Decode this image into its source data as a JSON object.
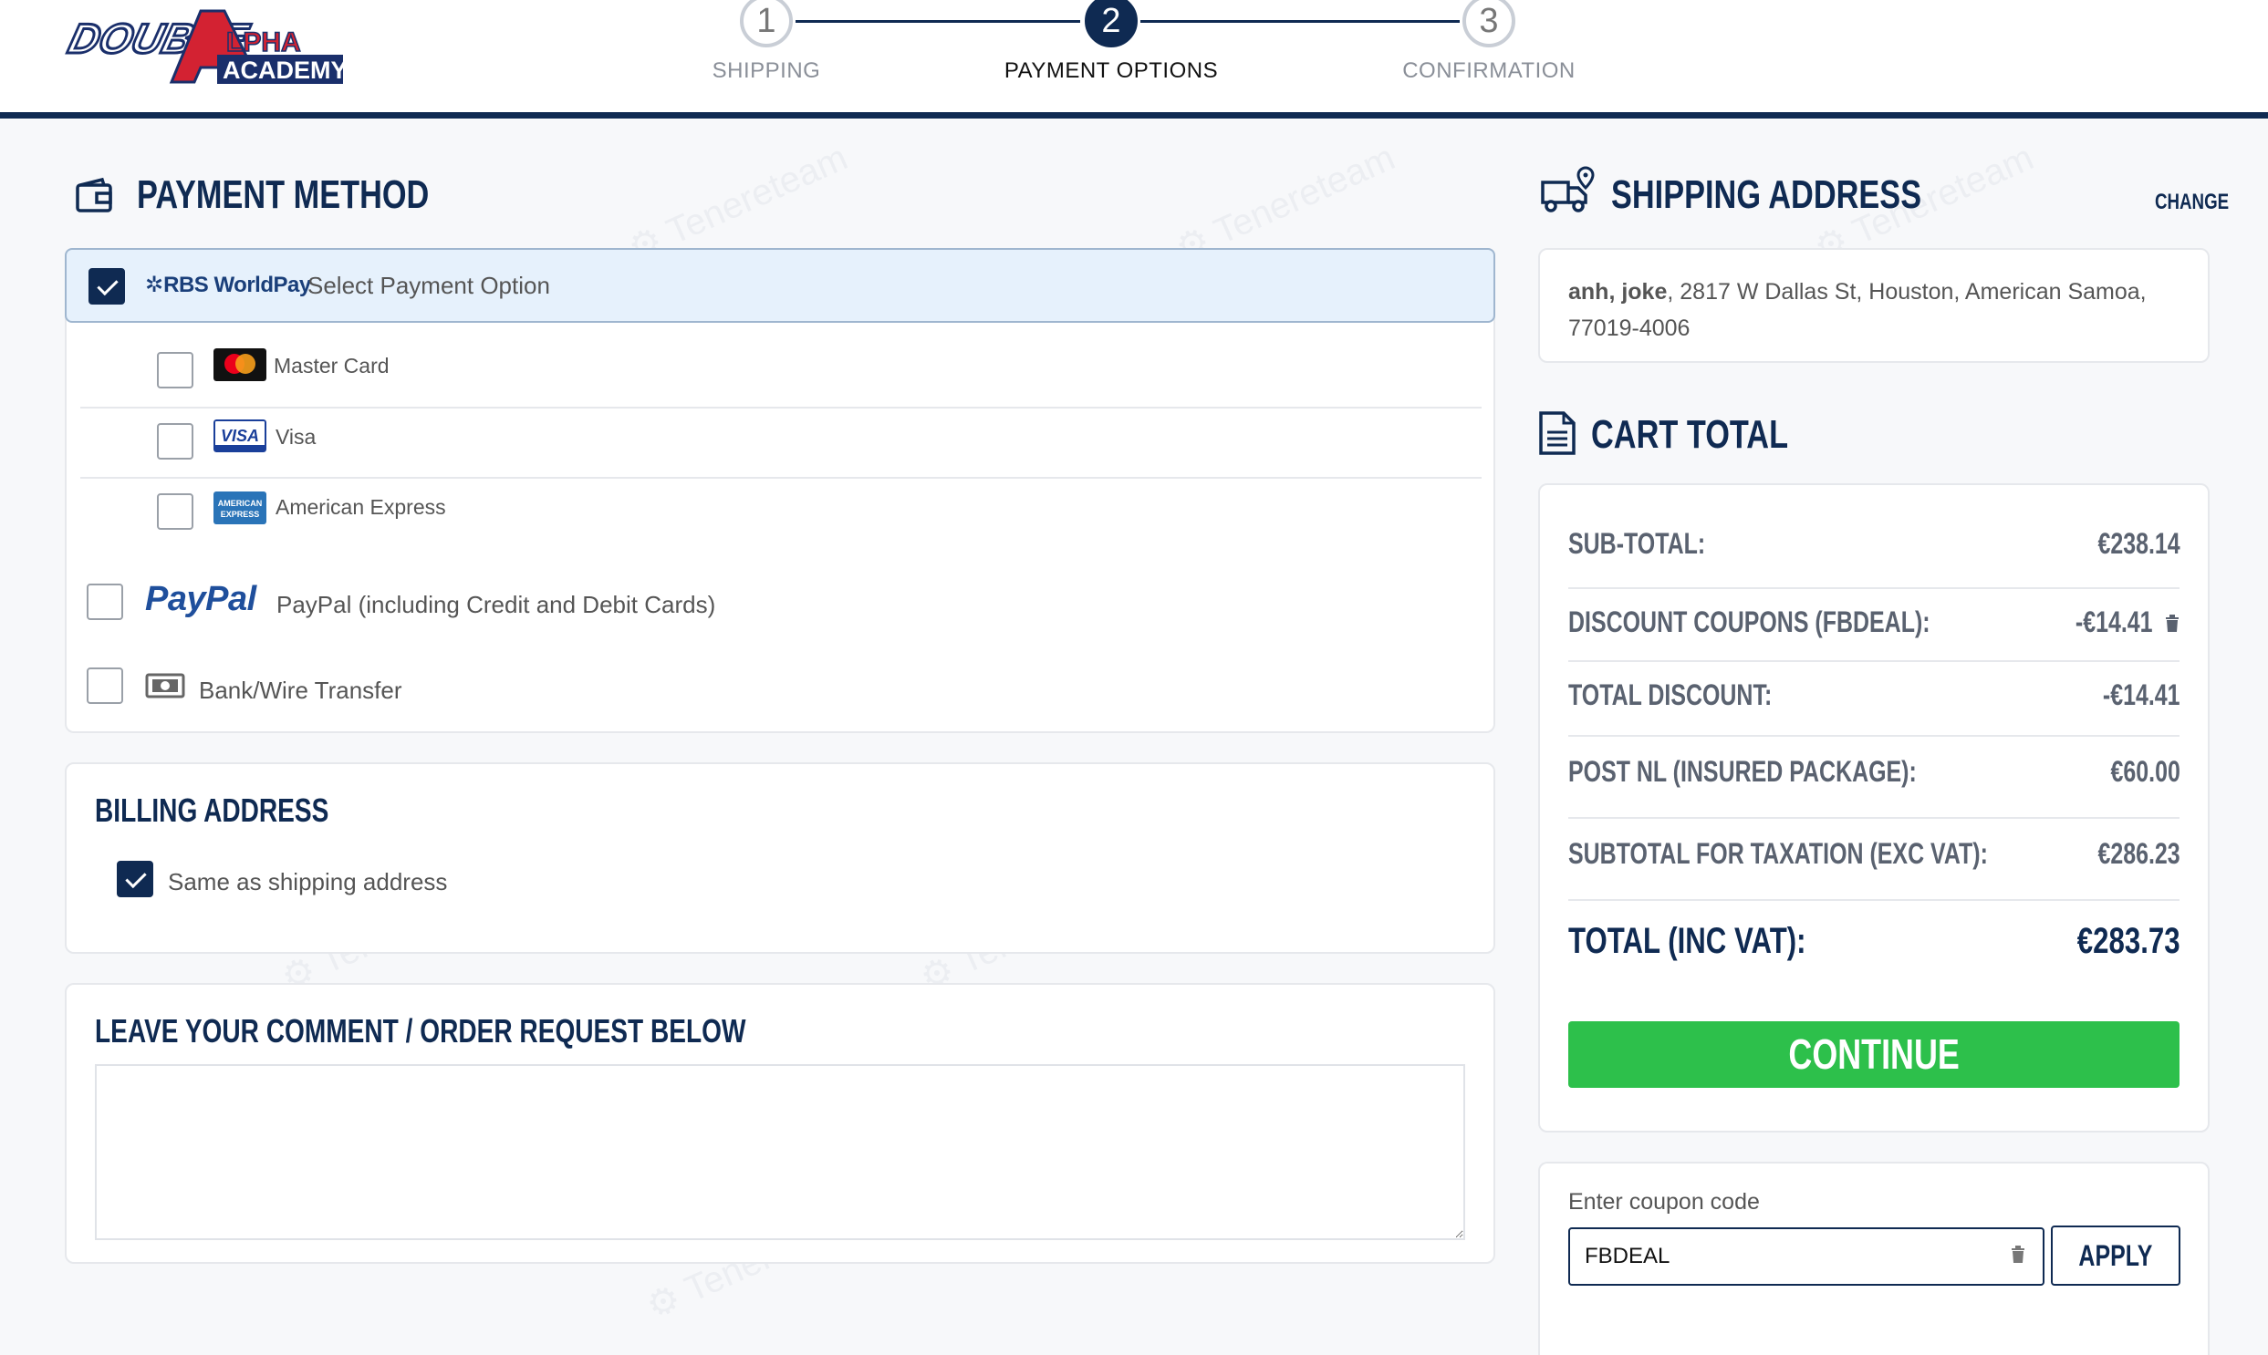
{
  "header": {
    "logo_text": "DOUBLE ALPHA ACADEMY",
    "steps": [
      {
        "number": "1",
        "label": "SHIPPING"
      },
      {
        "number": "2",
        "label": "PAYMENT OPTIONS"
      },
      {
        "number": "3",
        "label": "CONFIRMATION"
      }
    ],
    "active_step": 2
  },
  "payment": {
    "title": "PAYMENT METHOD",
    "worldpay": {
      "brand": "RBS WorldPay",
      "label": "Select Payment Option",
      "checked": true
    },
    "cards": [
      {
        "label": "Master Card",
        "icon": "mastercard-icon",
        "checked": false
      },
      {
        "label": "Visa",
        "icon": "visa-icon",
        "checked": false
      },
      {
        "label": "American Express",
        "icon": "amex-icon",
        "checked": false
      }
    ],
    "paypal": {
      "brand": "PayPal",
      "label": "PayPal (including Credit and Debit Cards)",
      "checked": false
    },
    "bank": {
      "label": "Bank/Wire Transfer",
      "icon": "banknote-icon",
      "checked": false
    }
  },
  "billing": {
    "title": "BILLING ADDRESS",
    "same_as_shipping_label": "Same as shipping address",
    "same_as_shipping": true
  },
  "comment": {
    "title": "LEAVE YOUR COMMENT / ORDER REQUEST BELOW",
    "value": ""
  },
  "shipping": {
    "title": "SHIPPING ADDRESS",
    "change_label": "CHANGE",
    "name": "anh, joke",
    "address_line1": ", 2817 W Dallas St, Houston, American Samoa,",
    "address_line2": "77019-4006"
  },
  "cart": {
    "title": "CART TOTAL",
    "rows": [
      {
        "label": "SUB-TOTAL:",
        "value": "€238.14"
      },
      {
        "label": "DISCOUNT COUPONS (FBDEAL):",
        "value": "-€14.41"
      },
      {
        "label": "TOTAL DISCOUNT:",
        "value": "-€14.41"
      },
      {
        "label": "POST NL  (INSURED PACKAGE):",
        "value": "€60.00"
      },
      {
        "label": "SUBTOTAL FOR TAXATION (EXC VAT):",
        "value": "€286.23"
      }
    ],
    "total_label": "TOTAL (INC VAT):",
    "total_value": "€283.73",
    "continue_label": "CONTINUE"
  },
  "coupon": {
    "label": "Enter coupon code",
    "value": "FBDEAL",
    "apply_label": "APPLY"
  },
  "colors": {
    "navy": "#0f2a52",
    "green": "#2dc04b",
    "selected_bg": "#e6f1fc"
  }
}
